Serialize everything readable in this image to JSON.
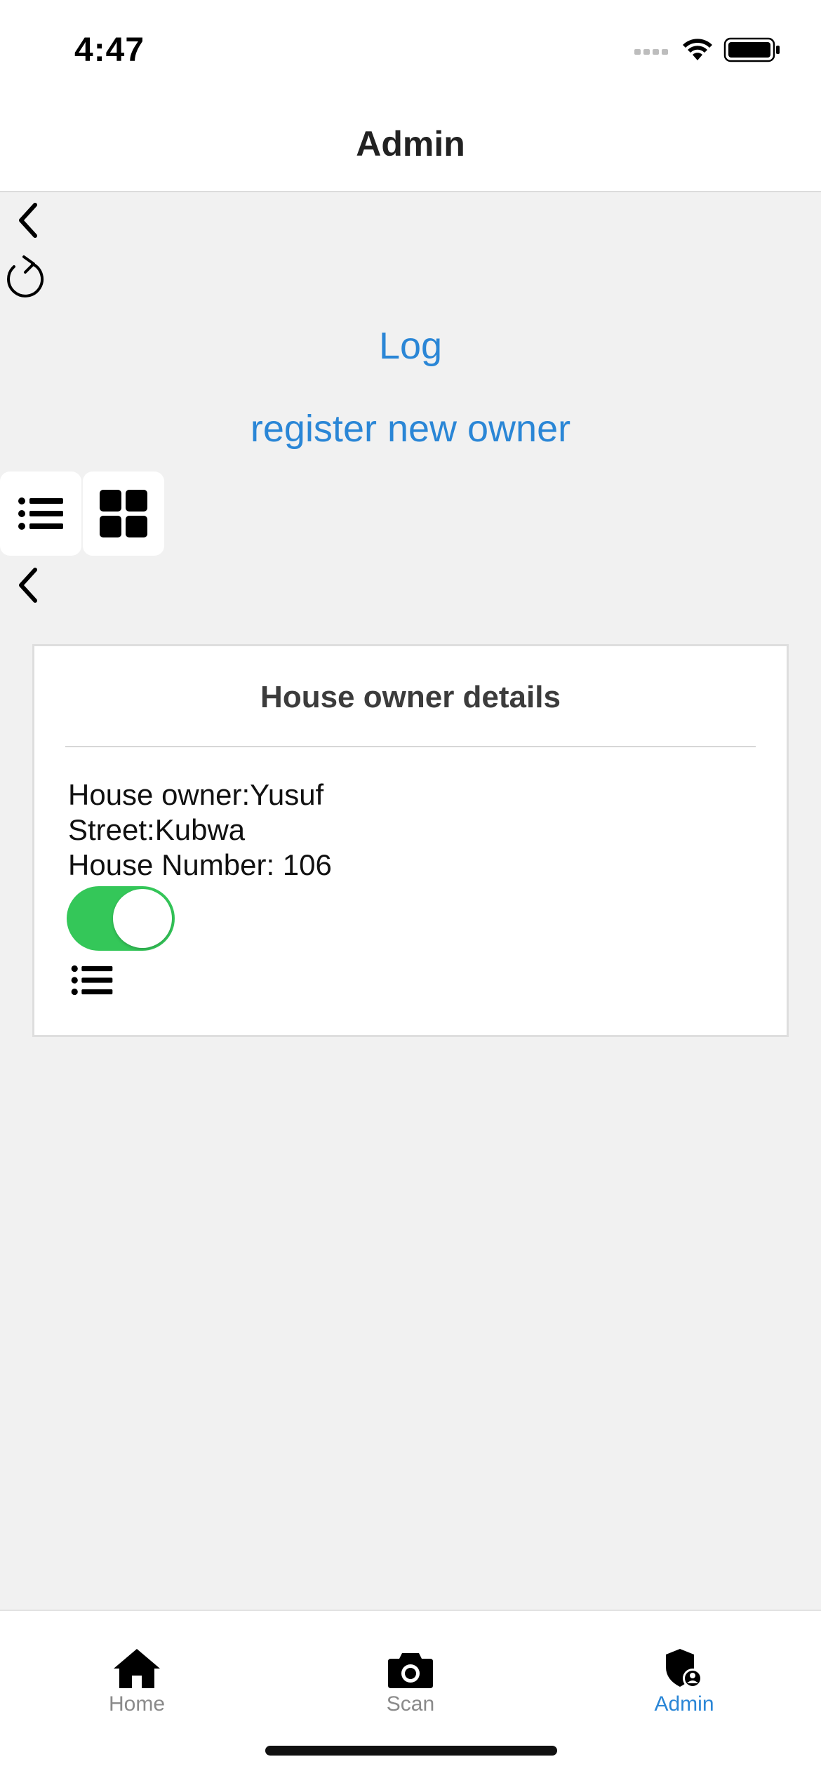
{
  "status_bar": {
    "time": "4:47"
  },
  "header": {
    "title": "Admin"
  },
  "links": {
    "log": "Log",
    "register": "register new owner"
  },
  "card": {
    "title": "House owner details",
    "owner_line": "House owner:Yusuf",
    "street_line": "Street:Kubwa",
    "house_number_line": "House Number: 106",
    "toggle_on": true
  },
  "tabs": [
    {
      "label": "Home",
      "icon": "home-icon",
      "active": false
    },
    {
      "label": "Scan",
      "icon": "camera-icon",
      "active": false
    },
    {
      "label": "Admin",
      "icon": "shield-user-icon",
      "active": true
    }
  ],
  "colors": {
    "accent": "#2a86d6",
    "toggle": "#34c759",
    "inactive_tab": "#8a8a8a"
  }
}
